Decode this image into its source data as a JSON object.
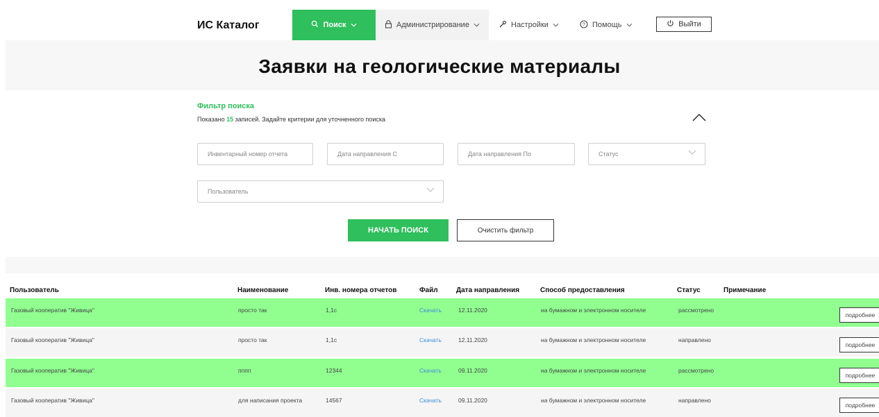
{
  "app": {
    "logo": "ИС Каталог"
  },
  "nav": {
    "search": "Поиск",
    "admin": "Администрирование",
    "settings": "Настройки",
    "help": "Помощь",
    "logout": "Выйти"
  },
  "page": {
    "title": "Заявки на геологические материалы"
  },
  "filter": {
    "title": "Фильтр поиска",
    "summary_prefix": "Показано",
    "count": "15",
    "summary_suffix": "записей. Задайте критерии для уточненного поиска",
    "fields": {
      "inventory": "Инвентарный номер отчета",
      "date_from": "Дата направления С",
      "date_to": "Дата направления По",
      "status": "Статус",
      "user": "Пользователь"
    },
    "start_button": "НАЧАТЬ ПОИСК",
    "clear_button": "Очистить фильтр"
  },
  "table": {
    "headers": {
      "user": "Пользователь",
      "name": "Наименование",
      "inv": "Инв. номера отчетов",
      "file": "Файл",
      "date": "Дата направления",
      "method": "Способ предоставления",
      "status": "Статус",
      "note": "Примечание"
    },
    "rows": [
      {
        "user": "Газовый кооператив \"Живица\"",
        "name": "просто так",
        "inv": "1,1c",
        "file": "Скачать",
        "date": "12.11.2020",
        "method": "на бумажном и электронном носителе",
        "status": "рассмотрено",
        "more": "подробнее",
        "highlight": "#90ff90"
      },
      {
        "user": "Газовый кооператив \"Живица\"",
        "name": "просто так",
        "inv": "1,1c",
        "file": "Скачать",
        "date": "12.11.2020",
        "method": "на бумажном и электронном носителе",
        "status": "направлено",
        "more": "подробнее",
        "highlight": "#f5f5f5"
      },
      {
        "user": "Газовый кооператив \"Живица\"",
        "name": "пппп",
        "inv": "12344",
        "file": "Скачать",
        "date": "09.11.2020",
        "method": "на бумажном и электронном носителе",
        "status": "рассмотрено",
        "more": "подробнее",
        "highlight": "#90ff90"
      },
      {
        "user": "Газовый кооператив \"Живица\"",
        "name": "для написания проекта",
        "inv": "14567",
        "file": "Скачать",
        "date": "09.11.2020",
        "method": "на бумажном и электронном носителе",
        "status": "направлено",
        "more": "подробнее",
        "highlight": "#f5f5f5"
      }
    ]
  },
  "colors": {
    "accent": "#2fbf5c",
    "row_reviewed": "#90ff90",
    "row_sent": "#f5f5f5",
    "link": "#3a8fd6"
  }
}
